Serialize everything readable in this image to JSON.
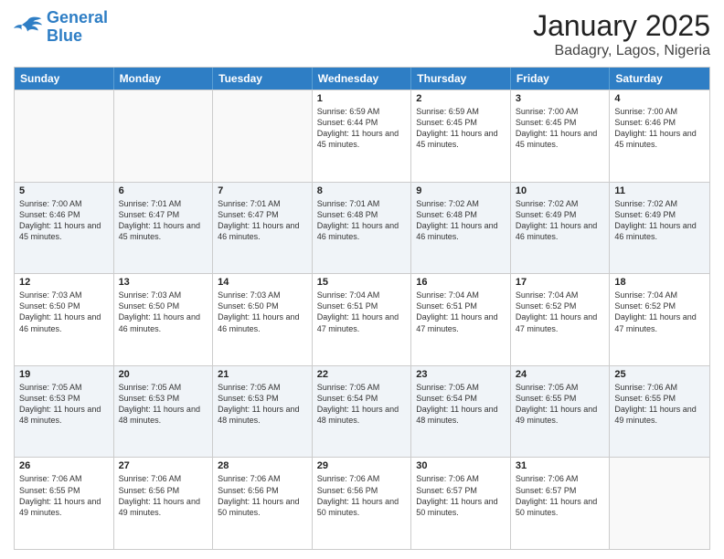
{
  "logo": {
    "line1": "General",
    "line2": "Blue"
  },
  "title": "January 2025",
  "location": "Badagry, Lagos, Nigeria",
  "days_of_week": [
    "Sunday",
    "Monday",
    "Tuesday",
    "Wednesday",
    "Thursday",
    "Friday",
    "Saturday"
  ],
  "weeks": [
    [
      {
        "day": "",
        "sunrise": "",
        "sunset": "",
        "daylight": ""
      },
      {
        "day": "",
        "sunrise": "",
        "sunset": "",
        "daylight": ""
      },
      {
        "day": "",
        "sunrise": "",
        "sunset": "",
        "daylight": ""
      },
      {
        "day": "1",
        "sunrise": "Sunrise: 6:59 AM",
        "sunset": "Sunset: 6:44 PM",
        "daylight": "Daylight: 11 hours and 45 minutes."
      },
      {
        "day": "2",
        "sunrise": "Sunrise: 6:59 AM",
        "sunset": "Sunset: 6:45 PM",
        "daylight": "Daylight: 11 hours and 45 minutes."
      },
      {
        "day": "3",
        "sunrise": "Sunrise: 7:00 AM",
        "sunset": "Sunset: 6:45 PM",
        "daylight": "Daylight: 11 hours and 45 minutes."
      },
      {
        "day": "4",
        "sunrise": "Sunrise: 7:00 AM",
        "sunset": "Sunset: 6:46 PM",
        "daylight": "Daylight: 11 hours and 45 minutes."
      }
    ],
    [
      {
        "day": "5",
        "sunrise": "Sunrise: 7:00 AM",
        "sunset": "Sunset: 6:46 PM",
        "daylight": "Daylight: 11 hours and 45 minutes."
      },
      {
        "day": "6",
        "sunrise": "Sunrise: 7:01 AM",
        "sunset": "Sunset: 6:47 PM",
        "daylight": "Daylight: 11 hours and 45 minutes."
      },
      {
        "day": "7",
        "sunrise": "Sunrise: 7:01 AM",
        "sunset": "Sunset: 6:47 PM",
        "daylight": "Daylight: 11 hours and 46 minutes."
      },
      {
        "day": "8",
        "sunrise": "Sunrise: 7:01 AM",
        "sunset": "Sunset: 6:48 PM",
        "daylight": "Daylight: 11 hours and 46 minutes."
      },
      {
        "day": "9",
        "sunrise": "Sunrise: 7:02 AM",
        "sunset": "Sunset: 6:48 PM",
        "daylight": "Daylight: 11 hours and 46 minutes."
      },
      {
        "day": "10",
        "sunrise": "Sunrise: 7:02 AM",
        "sunset": "Sunset: 6:49 PM",
        "daylight": "Daylight: 11 hours and 46 minutes."
      },
      {
        "day": "11",
        "sunrise": "Sunrise: 7:02 AM",
        "sunset": "Sunset: 6:49 PM",
        "daylight": "Daylight: 11 hours and 46 minutes."
      }
    ],
    [
      {
        "day": "12",
        "sunrise": "Sunrise: 7:03 AM",
        "sunset": "Sunset: 6:50 PM",
        "daylight": "Daylight: 11 hours and 46 minutes."
      },
      {
        "day": "13",
        "sunrise": "Sunrise: 7:03 AM",
        "sunset": "Sunset: 6:50 PM",
        "daylight": "Daylight: 11 hours and 46 minutes."
      },
      {
        "day": "14",
        "sunrise": "Sunrise: 7:03 AM",
        "sunset": "Sunset: 6:50 PM",
        "daylight": "Daylight: 11 hours and 46 minutes."
      },
      {
        "day": "15",
        "sunrise": "Sunrise: 7:04 AM",
        "sunset": "Sunset: 6:51 PM",
        "daylight": "Daylight: 11 hours and 47 minutes."
      },
      {
        "day": "16",
        "sunrise": "Sunrise: 7:04 AM",
        "sunset": "Sunset: 6:51 PM",
        "daylight": "Daylight: 11 hours and 47 minutes."
      },
      {
        "day": "17",
        "sunrise": "Sunrise: 7:04 AM",
        "sunset": "Sunset: 6:52 PM",
        "daylight": "Daylight: 11 hours and 47 minutes."
      },
      {
        "day": "18",
        "sunrise": "Sunrise: 7:04 AM",
        "sunset": "Sunset: 6:52 PM",
        "daylight": "Daylight: 11 hours and 47 minutes."
      }
    ],
    [
      {
        "day": "19",
        "sunrise": "Sunrise: 7:05 AM",
        "sunset": "Sunset: 6:53 PM",
        "daylight": "Daylight: 11 hours and 48 minutes."
      },
      {
        "day": "20",
        "sunrise": "Sunrise: 7:05 AM",
        "sunset": "Sunset: 6:53 PM",
        "daylight": "Daylight: 11 hours and 48 minutes."
      },
      {
        "day": "21",
        "sunrise": "Sunrise: 7:05 AM",
        "sunset": "Sunset: 6:53 PM",
        "daylight": "Daylight: 11 hours and 48 minutes."
      },
      {
        "day": "22",
        "sunrise": "Sunrise: 7:05 AM",
        "sunset": "Sunset: 6:54 PM",
        "daylight": "Daylight: 11 hours and 48 minutes."
      },
      {
        "day": "23",
        "sunrise": "Sunrise: 7:05 AM",
        "sunset": "Sunset: 6:54 PM",
        "daylight": "Daylight: 11 hours and 48 minutes."
      },
      {
        "day": "24",
        "sunrise": "Sunrise: 7:05 AM",
        "sunset": "Sunset: 6:55 PM",
        "daylight": "Daylight: 11 hours and 49 minutes."
      },
      {
        "day": "25",
        "sunrise": "Sunrise: 7:06 AM",
        "sunset": "Sunset: 6:55 PM",
        "daylight": "Daylight: 11 hours and 49 minutes."
      }
    ],
    [
      {
        "day": "26",
        "sunrise": "Sunrise: 7:06 AM",
        "sunset": "Sunset: 6:55 PM",
        "daylight": "Daylight: 11 hours and 49 minutes."
      },
      {
        "day": "27",
        "sunrise": "Sunrise: 7:06 AM",
        "sunset": "Sunset: 6:56 PM",
        "daylight": "Daylight: 11 hours and 49 minutes."
      },
      {
        "day": "28",
        "sunrise": "Sunrise: 7:06 AM",
        "sunset": "Sunset: 6:56 PM",
        "daylight": "Daylight: 11 hours and 50 minutes."
      },
      {
        "day": "29",
        "sunrise": "Sunrise: 7:06 AM",
        "sunset": "Sunset: 6:56 PM",
        "daylight": "Daylight: 11 hours and 50 minutes."
      },
      {
        "day": "30",
        "sunrise": "Sunrise: 7:06 AM",
        "sunset": "Sunset: 6:57 PM",
        "daylight": "Daylight: 11 hours and 50 minutes."
      },
      {
        "day": "31",
        "sunrise": "Sunrise: 7:06 AM",
        "sunset": "Sunset: 6:57 PM",
        "daylight": "Daylight: 11 hours and 50 minutes."
      },
      {
        "day": "",
        "sunrise": "",
        "sunset": "",
        "daylight": ""
      }
    ]
  ]
}
